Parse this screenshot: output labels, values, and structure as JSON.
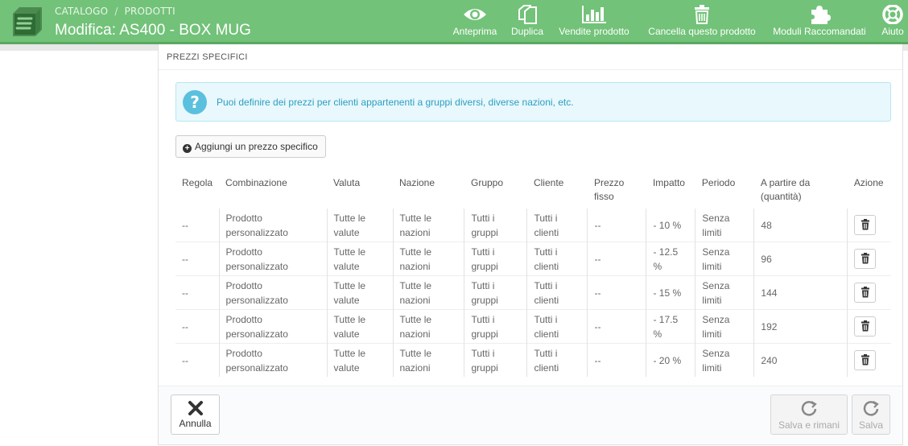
{
  "header": {
    "breadcrumb": [
      "CATALOGO",
      "PRODOTTI"
    ],
    "breadcrumb_sep": "/",
    "title": "Modifica: AS400 - BOX MUG",
    "toolbar": [
      {
        "label": "Anteprima",
        "icon": "eye-icon"
      },
      {
        "label": "Duplica",
        "icon": "copy-icon"
      },
      {
        "label": "Vendite prodotto",
        "icon": "bar-chart-icon"
      },
      {
        "label": "Cancella questo prodotto",
        "icon": "trash-icon"
      },
      {
        "label": "Moduli Raccomandati",
        "icon": "puzzle-icon"
      },
      {
        "label": "Aiuto",
        "icon": "lifebuoy-icon"
      }
    ],
    "accent_color": "#72c279"
  },
  "panel": {
    "heading": "PREZZI SPECIFICI",
    "alert_text": "Puoi definire dei prezzi per clienti appartenenti a gruppi diversi, diverse nazioni, etc.",
    "add_button": "Aggiungi un prezzo specifico"
  },
  "table": {
    "headers": [
      "Regola",
      "Combinazione",
      "Valuta",
      "Nazione",
      "Gruppo",
      "Cliente",
      "Prezzo fisso",
      "Impatto",
      "Periodo",
      "A partire da (quantità)",
      "Azione"
    ],
    "rows": [
      {
        "rule": "--",
        "combination": "Prodotto personalizzato",
        "currency": "Tutte le valute",
        "country": "Tutte le nazioni",
        "group": "Tutti i gruppi",
        "customer": "Tutti i clienti",
        "fixed_price": "--",
        "impact": "- 10 %",
        "period": "Senza limiti",
        "from_qty": "48"
      },
      {
        "rule": "--",
        "combination": "Prodotto personalizzato",
        "currency": "Tutte le valute",
        "country": "Tutte le nazioni",
        "group": "Tutti i gruppi",
        "customer": "Tutti i clienti",
        "fixed_price": "--",
        "impact": "- 12.5 %",
        "period": "Senza limiti",
        "from_qty": "96"
      },
      {
        "rule": "--",
        "combination": "Prodotto personalizzato",
        "currency": "Tutte le valute",
        "country": "Tutte le nazioni",
        "group": "Tutti i gruppi",
        "customer": "Tutti i clienti",
        "fixed_price": "--",
        "impact": "- 15 %",
        "period": "Senza limiti",
        "from_qty": "144"
      },
      {
        "rule": "--",
        "combination": "Prodotto personalizzato",
        "currency": "Tutte le valute",
        "country": "Tutte le nazioni",
        "group": "Tutti i gruppi",
        "customer": "Tutti i clienti",
        "fixed_price": "--",
        "impact": "- 17.5 %",
        "period": "Senza limiti",
        "from_qty": "192"
      },
      {
        "rule": "--",
        "combination": "Prodotto personalizzato",
        "currency": "Tutte le valute",
        "country": "Tutte le nazioni",
        "group": "Tutti i gruppi",
        "customer": "Tutti i clienti",
        "fixed_price": "--",
        "impact": "- 20 %",
        "period": "Senza limiti",
        "from_qty": "240"
      }
    ]
  },
  "footer": {
    "cancel": "Annulla",
    "save_stay": "Salva e rimani",
    "save": "Salva"
  }
}
